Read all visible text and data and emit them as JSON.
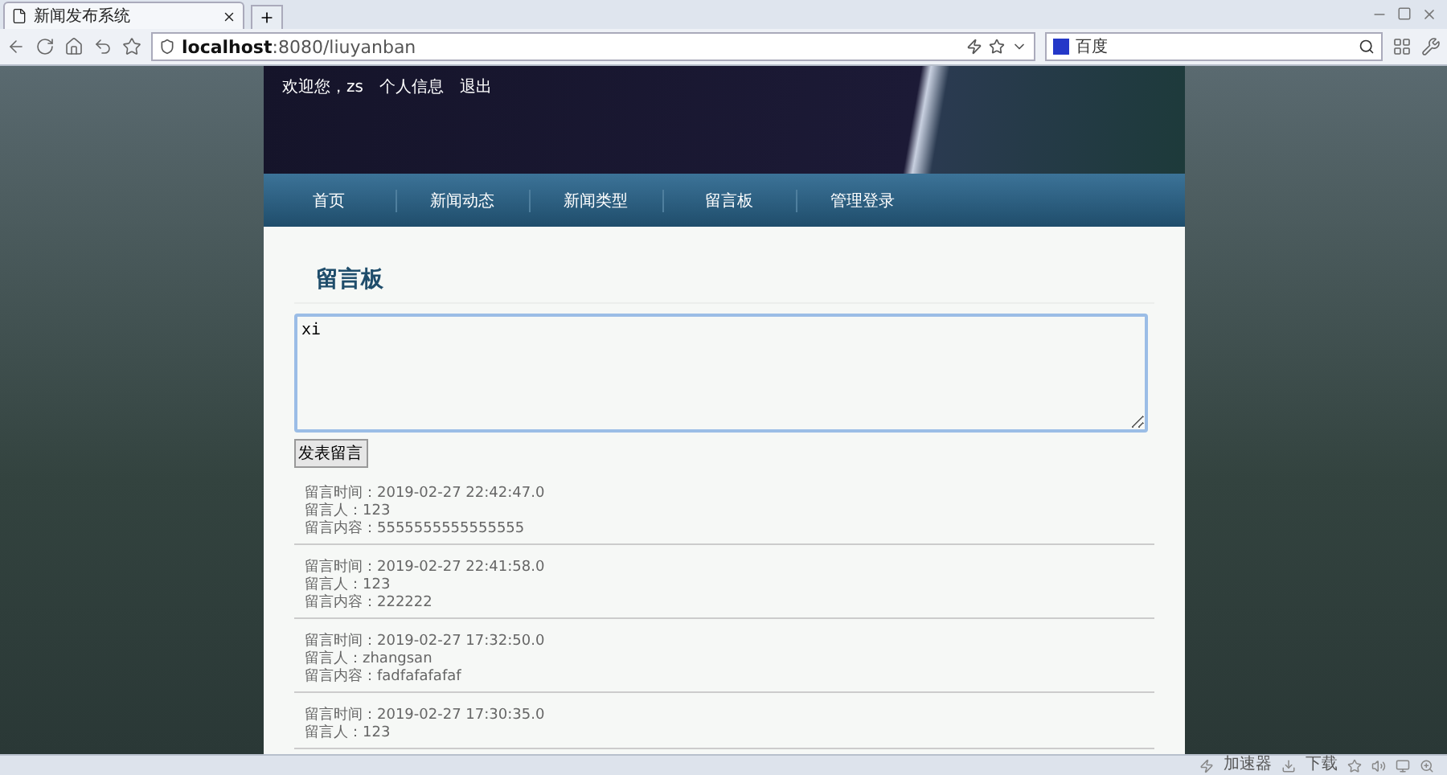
{
  "browser": {
    "tab_title": "新闻发布系统",
    "url_host": "localhost",
    "url_path": ":8080/liuyanban",
    "search_engine": "百度"
  },
  "header": {
    "welcome": "欢迎您，zs",
    "links": [
      "个人信息",
      "退出"
    ]
  },
  "nav": [
    "首页",
    "新闻动态",
    "新闻类型",
    "留言板",
    "管理登录"
  ],
  "board": {
    "title": "留言板",
    "message_value": "xi",
    "submit": "发表留言",
    "messages": [
      {
        "lines": [
          "留言时间：2019-02-27 22:42:47.0",
          "留言人：123",
          "留言内容：5555555555555555"
        ]
      },
      {
        "lines": [
          "留言时间：2019-02-27 22:41:58.0",
          "留言人：123",
          "留言内容：222222"
        ]
      },
      {
        "lines": [
          "留言时间：2019-02-27 17:32:50.0",
          "留言人：zhangsan",
          "留言内容：fadfafafafaf"
        ]
      },
      {
        "lines": [
          "留言时间：2019-02-27 17:30:35.0",
          "留言人：123"
        ]
      }
    ]
  },
  "status_bar": [
    "加速器",
    "下载"
  ]
}
